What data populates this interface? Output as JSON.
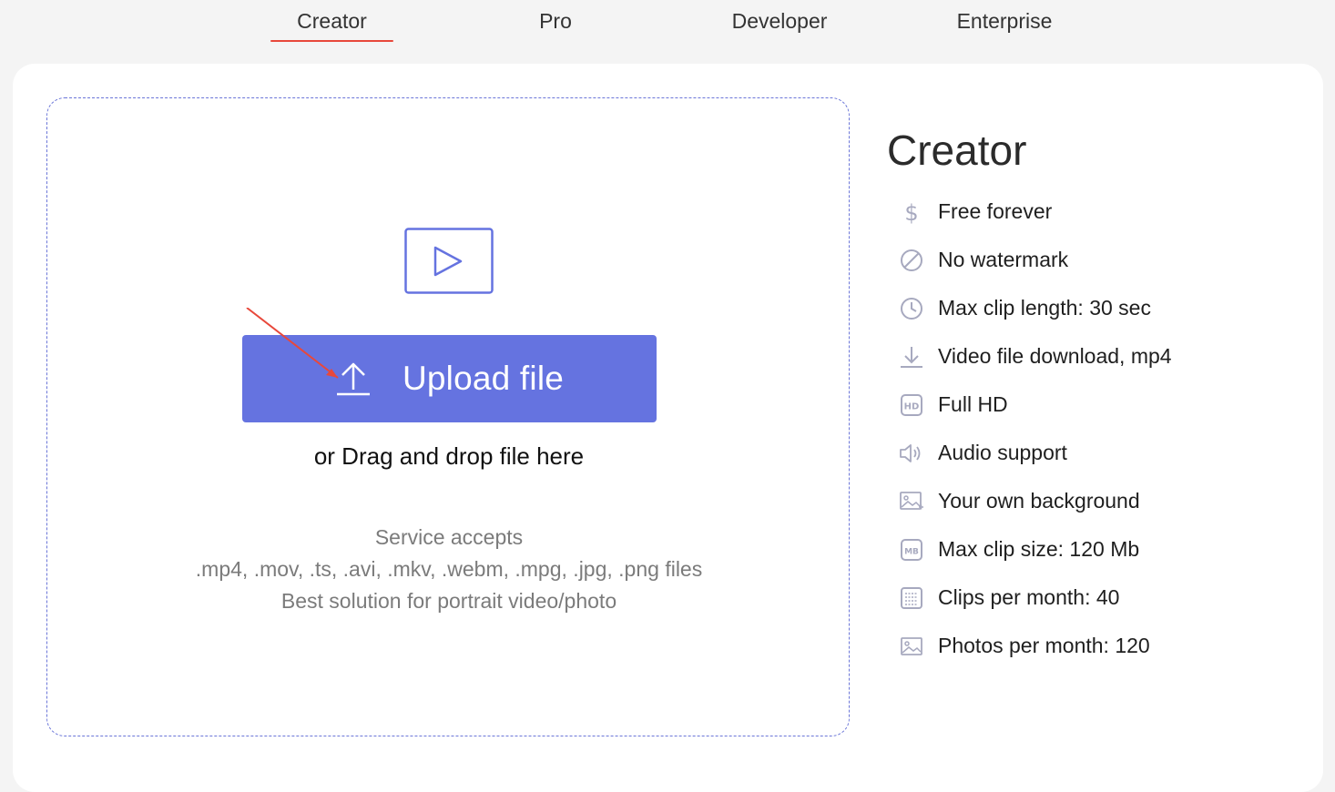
{
  "tabs": [
    {
      "label": "Creator",
      "active": true
    },
    {
      "label": "Pro",
      "active": false
    },
    {
      "label": "Developer",
      "active": false
    },
    {
      "label": "Enterprise",
      "active": false
    }
  ],
  "upload": {
    "button_label": "Upload file",
    "drag_text": "or Drag and drop file here",
    "accepts_line1": "Service accepts",
    "accepts_line2": ".mp4, .mov, .ts, .avi, .mkv, .webm, .mpg, .jpg, .png files",
    "accepts_line3": "Best solution for portrait video/photo"
  },
  "plan": {
    "title": "Creator",
    "features": [
      {
        "icon": "dollar-icon",
        "label": "Free forever"
      },
      {
        "icon": "no-watermark-icon",
        "label": "No watermark"
      },
      {
        "icon": "clock-icon",
        "label": "Max clip length: 30 sec"
      },
      {
        "icon": "download-icon",
        "label": "Video file download, mp4"
      },
      {
        "icon": "hd-icon",
        "label": "Full HD"
      },
      {
        "icon": "audio-icon",
        "label": "Audio support"
      },
      {
        "icon": "background-image-icon",
        "label": "Your own background"
      },
      {
        "icon": "mb-icon",
        "label": "Max clip size: 120 Mb"
      },
      {
        "icon": "calendar-icon",
        "label": "Clips per month: 40"
      },
      {
        "icon": "photo-icon",
        "label": "Photos per month: 120"
      }
    ]
  },
  "colors": {
    "accent": "#6573e0",
    "tab_underline": "#e8483b",
    "annotation_arrow": "#e8483b"
  }
}
